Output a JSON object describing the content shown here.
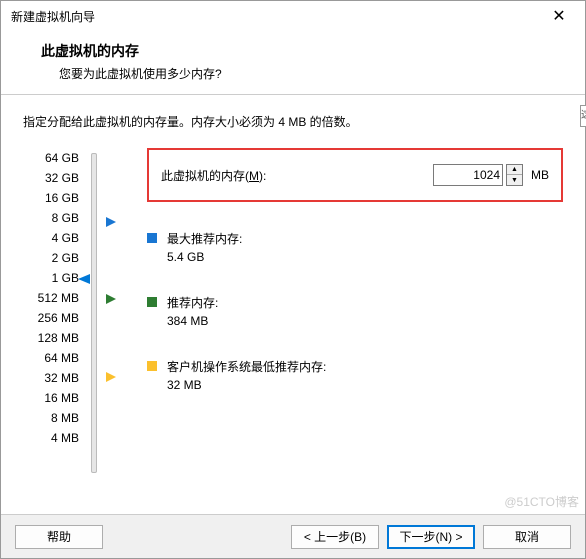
{
  "window": {
    "title": "新建虚拟机向导"
  },
  "header": {
    "title": "此虚拟机的内存",
    "subtitle": "您要为此虚拟机使用多少内存?"
  },
  "instruction": "指定分配给此虚拟机的内存量。内存大小必须为 4 MB 的倍数。",
  "slider": {
    "ticks": [
      "64 GB",
      "32 GB",
      "16 GB",
      "8 GB",
      "4 GB",
      "2 GB",
      "1 GB",
      "512 MB",
      "256 MB",
      "128 MB",
      "64 MB",
      "32 MB",
      "16 MB",
      "8 MB",
      "4 MB"
    ]
  },
  "memory": {
    "label_prefix": "此虚拟机的内存(",
    "label_accel": "M",
    "label_suffix": "):",
    "value": "1024",
    "unit": "MB"
  },
  "recommend": {
    "max_label": "最大推荐内存:",
    "max_value": "5.4 GB",
    "rec_label": "推荐内存:",
    "rec_value": "384 MB",
    "min_label": "客户机操作系统最低推荐内存:",
    "min_value": "32 MB"
  },
  "buttons": {
    "help": "帮助",
    "back": "< 上一步(B)",
    "next": "下一步(N) >",
    "cancel": "取消"
  },
  "watermark": "@51CTO博客",
  "side_hint": "这"
}
